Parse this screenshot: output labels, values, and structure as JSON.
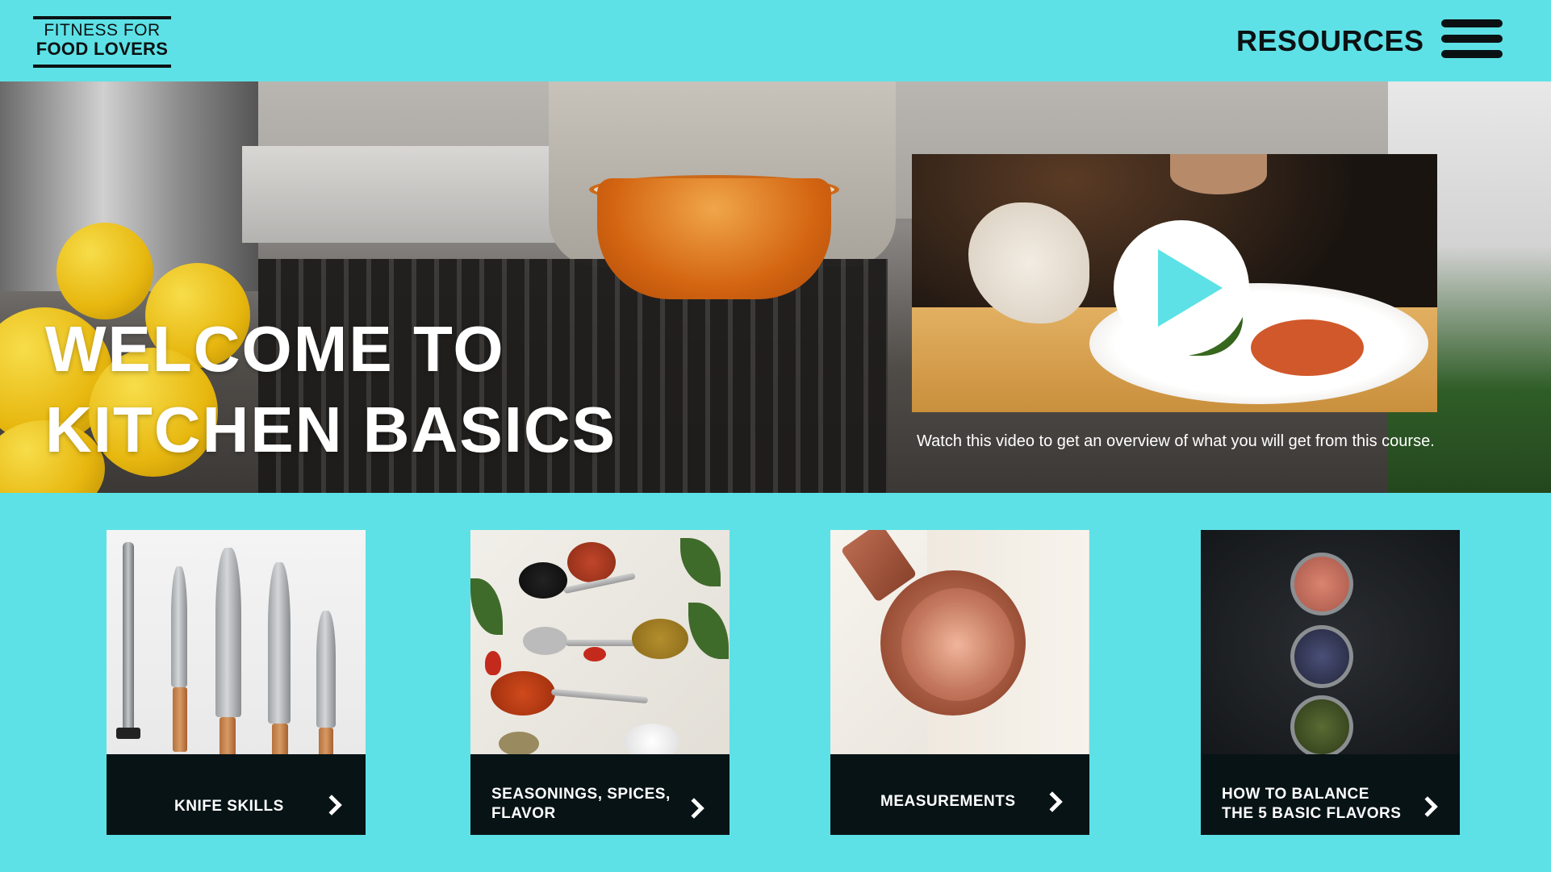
{
  "header": {
    "logo_line1": "FITNESS FOR",
    "logo_line2": "FOOD LOVERS",
    "resources_label": "RESOURCES",
    "menu_icon": "hamburger-menu-icon"
  },
  "hero": {
    "title": "WELCOME TO\nKITCHEN BASICS",
    "video": {
      "play_icon": "play-icon",
      "caption": "Watch this video to get an overview of what you will get from this course."
    }
  },
  "cards": [
    {
      "label": "KNIFE SKILLS",
      "image": "knives-photo",
      "icon": "chevron-right-icon"
    },
    {
      "label": "SEASONINGS, SPICES,\nFLAVOR",
      "image": "spices-photo",
      "icon": "chevron-right-icon"
    },
    {
      "label": "MEASUREMENTS",
      "image": "measuring-cups-photo",
      "icon": "chevron-right-icon"
    },
    {
      "label": "HOW TO BALANCE\nTHE 5 BASIC FLAVORS",
      "image": "spice-bowls-photo",
      "icon": "chevron-right-icon"
    }
  ],
  "colors": {
    "accent": "#5de1e6",
    "dark": "#081316",
    "text_light": "#ffffff"
  }
}
